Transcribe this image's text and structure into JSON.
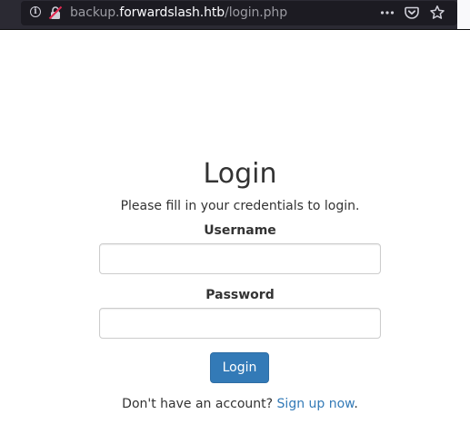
{
  "browser": {
    "url_scheme_prefix": "backup.",
    "url_host": "forwardslash.htb",
    "url_path": "/login.php",
    "icons": [
      "info-icon",
      "insecure-connection-icon",
      "more-actions-icon",
      "pocket-icon",
      "bookmark-star-icon"
    ]
  },
  "login": {
    "title": "Login",
    "intro": "Please fill in your credentials to login.",
    "username_label": "Username",
    "username_value": "",
    "password_label": "Password",
    "password_value": "",
    "submit_label": "Login",
    "signup_prompt": "Don't have an account?",
    "signup_link": "Sign up now",
    "signup_suffix": "."
  },
  "colors": {
    "primary": "#337ab7",
    "text": "#333333",
    "toolbar": "#2b2a33",
    "urlbar": "#1c1b22"
  }
}
